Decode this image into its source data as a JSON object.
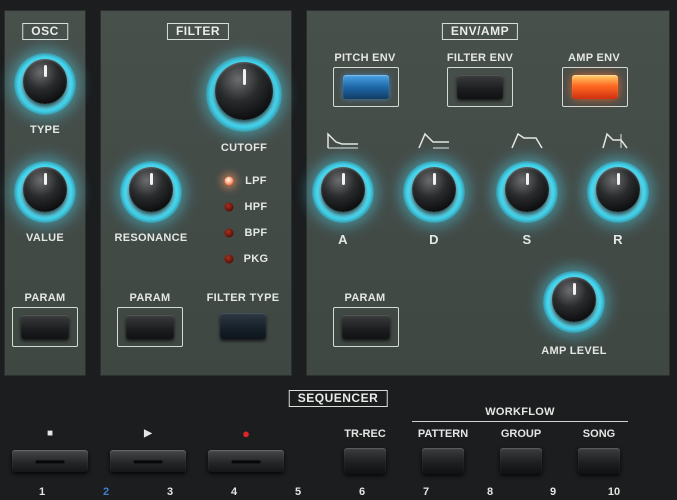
{
  "osc": {
    "title": "OSC",
    "type_label": "TYPE",
    "value_label": "VALUE",
    "param_label": "PARAM"
  },
  "filter": {
    "title": "FILTER",
    "cutoff_label": "CUTOFF",
    "resonance_label": "RESONANCE",
    "param_label": "PARAM",
    "filter_type_label": "FILTER TYPE",
    "types": [
      {
        "label": "LPF",
        "active": true
      },
      {
        "label": "HPF",
        "active": false
      },
      {
        "label": "BPF",
        "active": false
      },
      {
        "label": "PKG",
        "active": false
      }
    ]
  },
  "env_amp": {
    "title": "ENV/AMP",
    "pitch_env_label": "PITCH ENV",
    "filter_env_label": "FILTER ENV",
    "amp_env_label": "AMP ENV",
    "a_label": "A",
    "d_label": "D",
    "s_label": "S",
    "r_label": "R",
    "param_label": "PARAM",
    "amp_level_label": "AMP LEVEL"
  },
  "sequencer": {
    "title": "SEQUENCER",
    "workflow_label": "WORKFLOW",
    "stop_symbol": "■",
    "play_symbol": "▶",
    "rec_symbol": "●",
    "tr_rec_label": "TR-REC",
    "pattern_label": "PATTERN",
    "group_label": "GROUP",
    "song_label": "SONG",
    "numbers": [
      "1",
      "2",
      "3",
      "4",
      "5",
      "6",
      "7",
      "8",
      "9",
      "10"
    ]
  },
  "colors": {
    "knob_glow": "#3fd4ee",
    "led_active": "#ff6a3c",
    "amp_env_button": "#ff6a22",
    "pitch_env_button": "#1f68a8",
    "rec_symbol": "#e0242a"
  }
}
